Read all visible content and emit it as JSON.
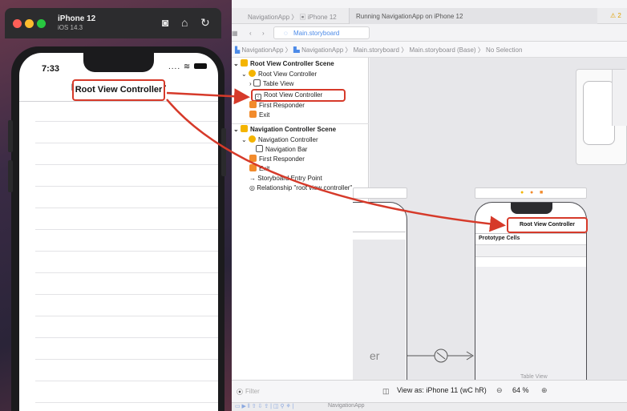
{
  "simulator": {
    "device_name": "iPhone 12",
    "os_version": "iOS 14.3",
    "status_time": "7:33",
    "status_indicators": "....",
    "nav_title": "Root View Controller"
  },
  "xcode": {
    "breadcrumb_top": [
      "NavigationApp",
      "iPhone 12"
    ],
    "run_status": "Running NavigationApp on iPhone 12",
    "warning_count": "2",
    "tab_label": "Main.storyboard",
    "jump_bar": [
      "NavigationApp",
      "NavigationApp",
      "Main.storyboard",
      "Main.storyboard (Base)",
      "No Selection"
    ],
    "outline": {
      "scene1": "Root View Controller Scene",
      "scene1_vc": "Root View Controller",
      "scene1_tableview": "Table View",
      "scene1_navitem": "Root View Controller",
      "scene1_responder": "First Responder",
      "scene1_exit": "Exit",
      "scene2": "Navigation Controller Scene",
      "scene2_nc": "Navigation Controller",
      "scene2_navbar": "Navigation Bar",
      "scene2_responder": "First Responder",
      "scene2_exit": "Exit",
      "entry_point": "Storyboard Entry Point",
      "relationship": "Relationship \"root view controller\"..."
    },
    "filter_placeholder": "Filter",
    "view_as": "View as: iPhone 11 (",
    "view_as_shortcut": "wC hR)",
    "zoom": "64 %",
    "canvas_nav_title": "Root View Controller",
    "prototype_cells": "Prototype Cells",
    "table_view_label": "Table View",
    "partial_label": "er",
    "bottom_target": "NavigationApp"
  },
  "colors": {
    "annotation": "#d63a2a",
    "scene_yellow": "#f4b400",
    "accent_blue": "#2f7cf6"
  }
}
